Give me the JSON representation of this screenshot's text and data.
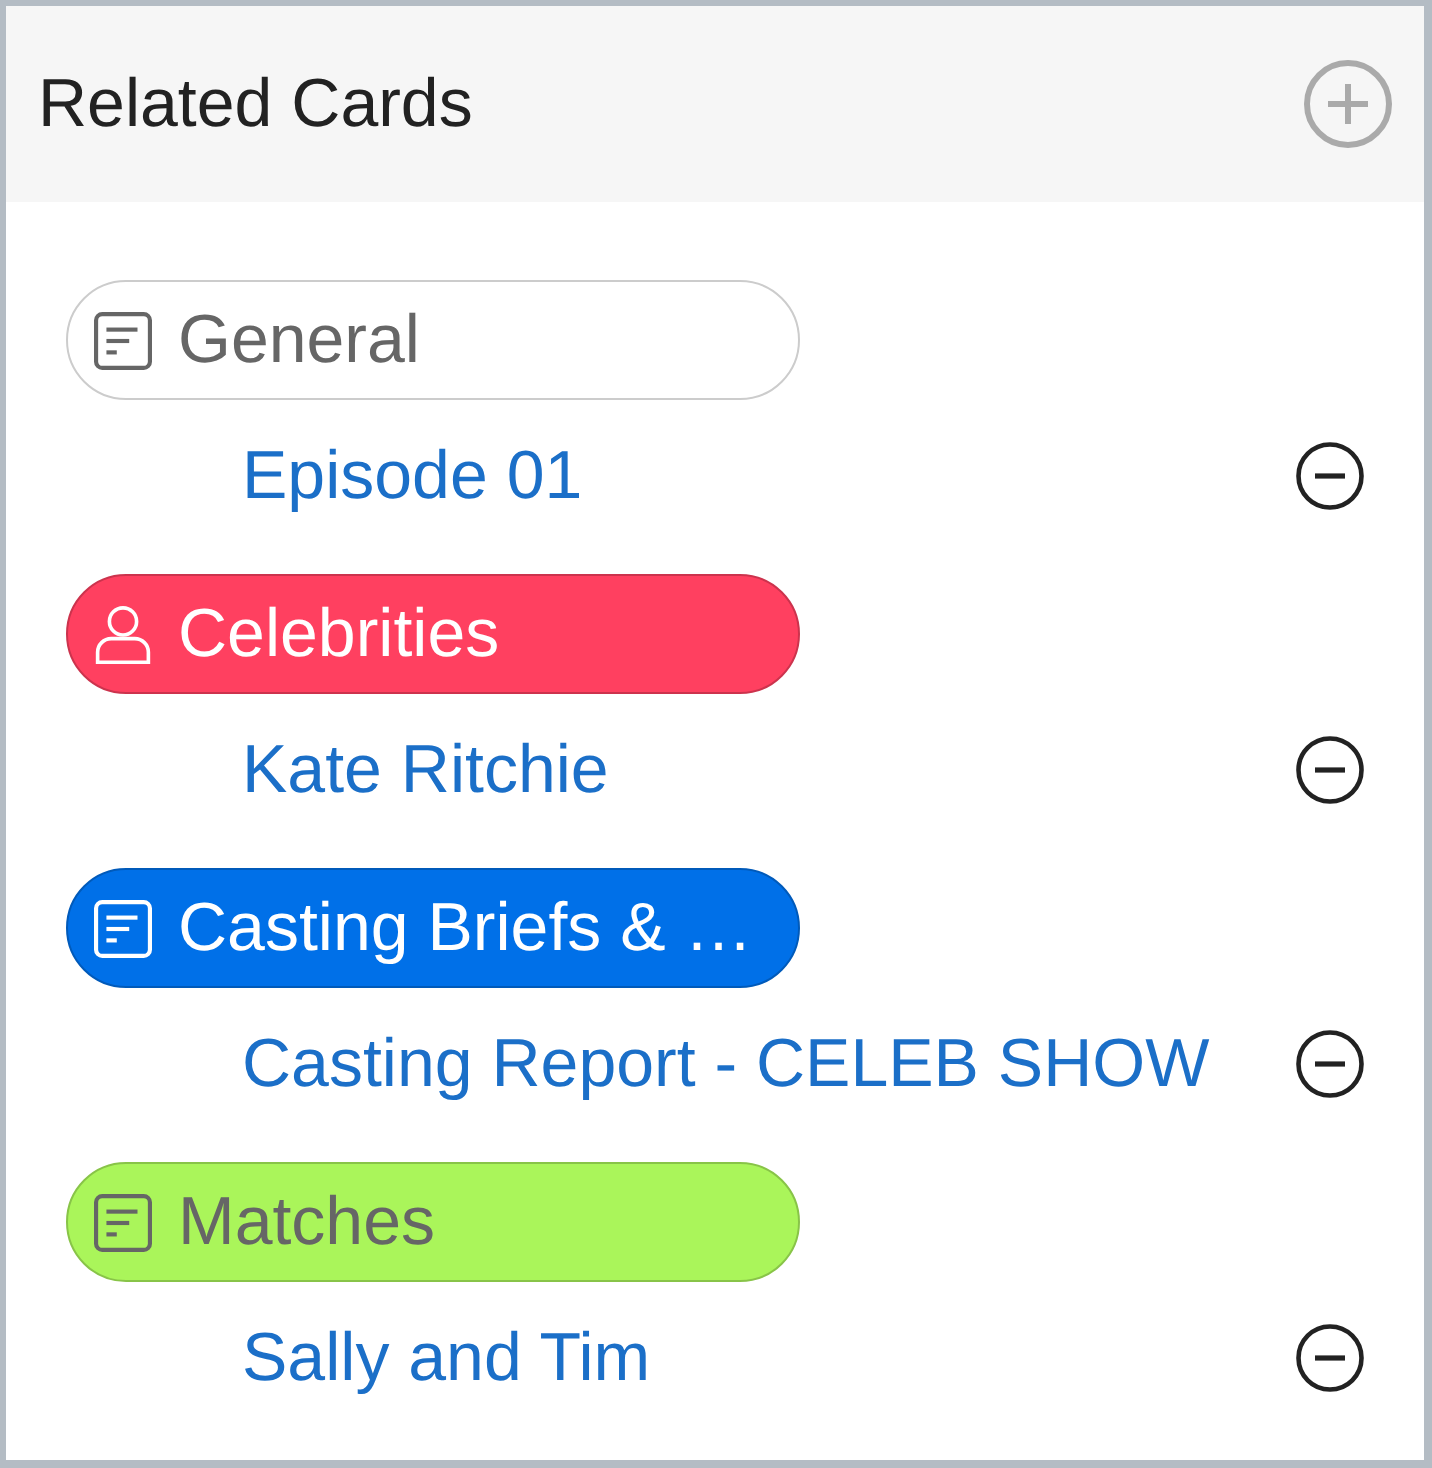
{
  "header": {
    "title": "Related Cards"
  },
  "groups": [
    {
      "label": "General",
      "kind": "document",
      "color": "#ffffff",
      "cards": [
        {
          "title": "Episode 01"
        }
      ]
    },
    {
      "label": "Celebrities",
      "kind": "person",
      "color": "#ff4060",
      "cards": [
        {
          "title": "Kate Ritchie"
        }
      ]
    },
    {
      "label": "Casting Briefs & …",
      "kind": "document",
      "color": "#0070e8",
      "cards": [
        {
          "title": "Casting Report - CELEB SHOW"
        }
      ]
    },
    {
      "label": "Matches",
      "kind": "document",
      "color": "#aaf55a",
      "cards": [
        {
          "title": "Sally and Tim"
        }
      ]
    }
  ]
}
